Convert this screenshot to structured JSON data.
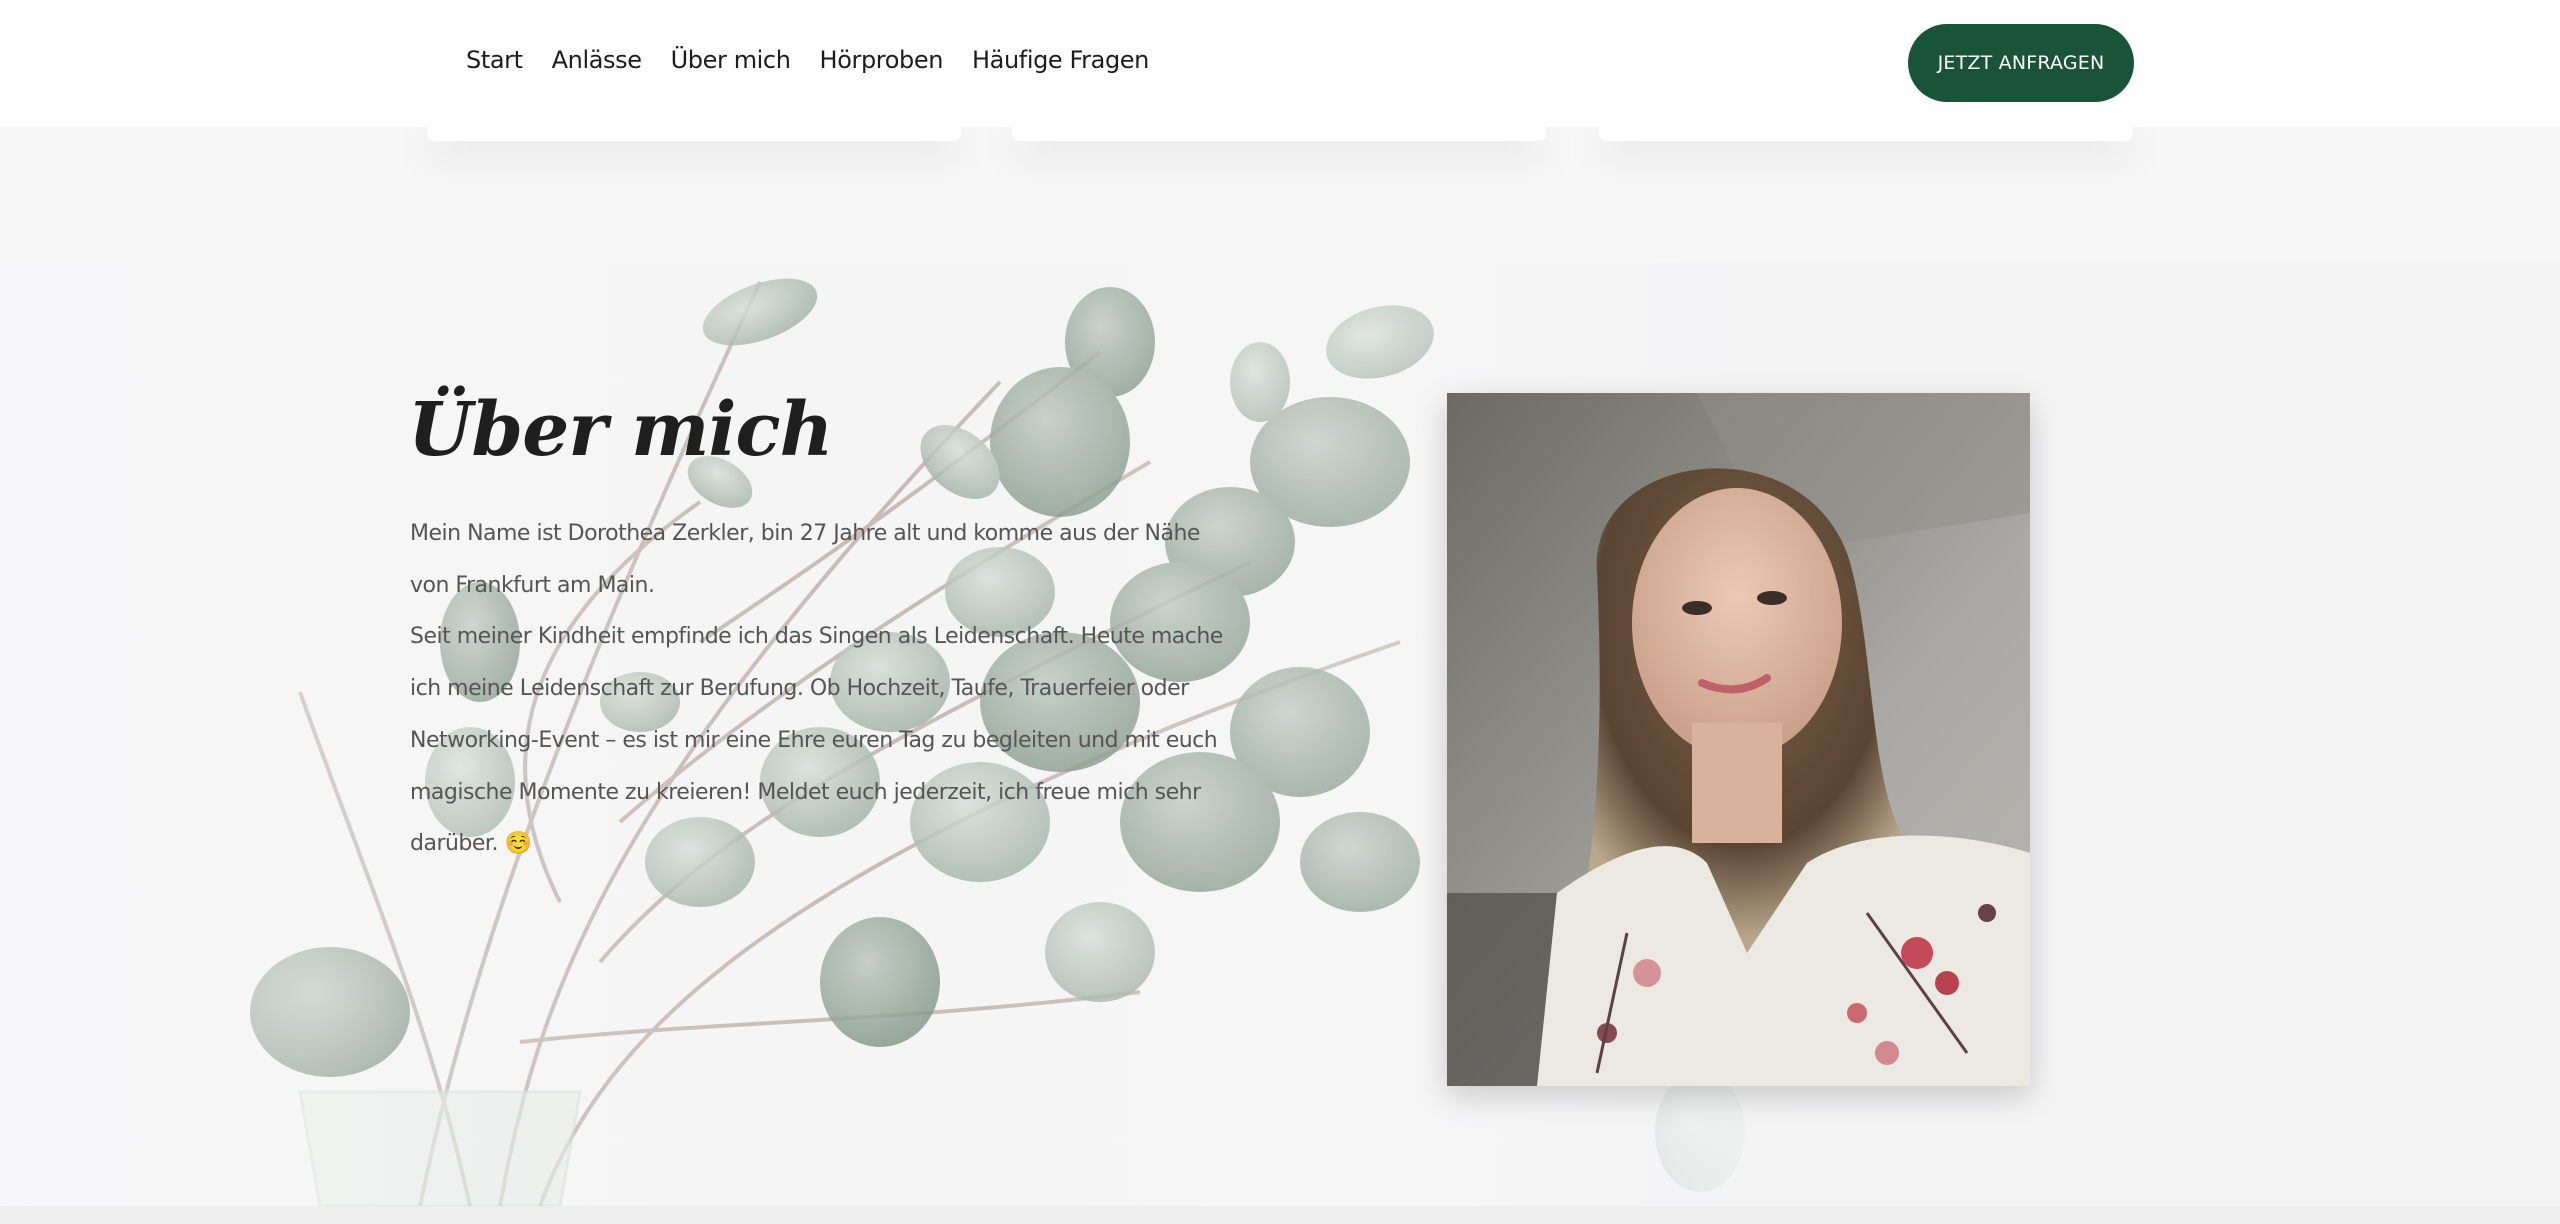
{
  "header": {
    "nav": [
      "Start",
      "Anlässe",
      "Über mich",
      "Hörproben",
      "Häufige Fragen"
    ],
    "cta_label": "JETZT ANFRAGEN"
  },
  "about": {
    "title": "Über mich",
    "paragraph_1": "Mein Name ist Dorothea Zerkler, bin 27 Jahre alt und komme aus der Nähe von Frankfurt am Main.",
    "paragraph_2": "Seit meiner Kindheit empfinde ich das Singen als Leidenschaft. Heute mache ich meine Leidenschaft zur Berufung. Ob Hochzeit, Taufe, Trauerfeier oder Networking-Event – es ist mir eine Ehre euren Tag zu begleiten und mit euch magische Momente zu kreieren! Meldet euch jederzeit, ich freue mich sehr darüber. ☺️"
  },
  "colors": {
    "accent": "#1a5438",
    "text": "#555555",
    "heading": "#1f1f1f"
  }
}
